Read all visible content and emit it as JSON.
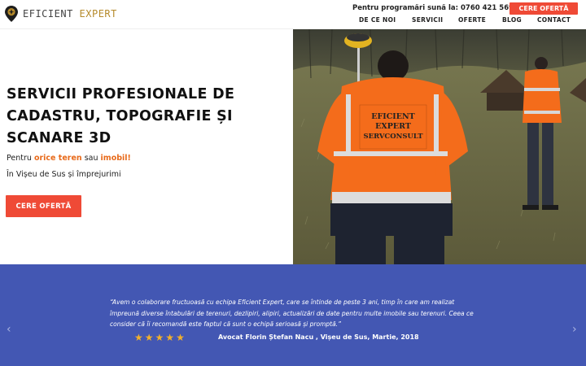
{
  "header": {
    "logo_word1": "EFICIENT",
    "logo_word2": "EXPERT",
    "call_label": "Pentru programări sună la:",
    "phone": "0760 421 569",
    "cta": "CERE OFERTĂ"
  },
  "nav": {
    "items": [
      "DE CE NOI",
      "SERVICII",
      "OFERTE",
      "BLOG",
      "CONTACT"
    ]
  },
  "hero": {
    "title": "SERVICII PROFESIONALE DE CADASTRU, TOPOGRAFIE ȘI SCANARE 3D",
    "sub_prefix": "Pentru",
    "sub_hl1": "orice teren",
    "sub_mid": "sau",
    "sub_hl2": "imobil!",
    "location": "În Vișeu de Sus și împrejurimi",
    "cta": "CERE OFERTĂ",
    "vest_line1": "EFICIENT",
    "vest_line2": "EXPERT",
    "vest_line3": "SERVCONSULT"
  },
  "testimonial": {
    "quote": "“Avem o colaborare fructuoasă cu echipa Eficient Expert, care se întinde de peste 3 ani, timp în care am realizat împreună diverse întabulări de terenuri, dezlipiri, alipiri, actualizări de date pentru multe imobile sau terenuri. Ceea ce consider că îi recomandă este faptul că sunt o echipă serioasă și promptă.”",
    "rating": 5,
    "author": "Avocat Florin Ștefan Nacu , Vișeu de Sus, Martie, 2018",
    "prev": "‹",
    "next": "›"
  },
  "colors": {
    "accent": "#ef4a36",
    "highlight": "#e86a1a",
    "testimonial_bg": "#4357b3",
    "stars": "#f2b02b"
  }
}
